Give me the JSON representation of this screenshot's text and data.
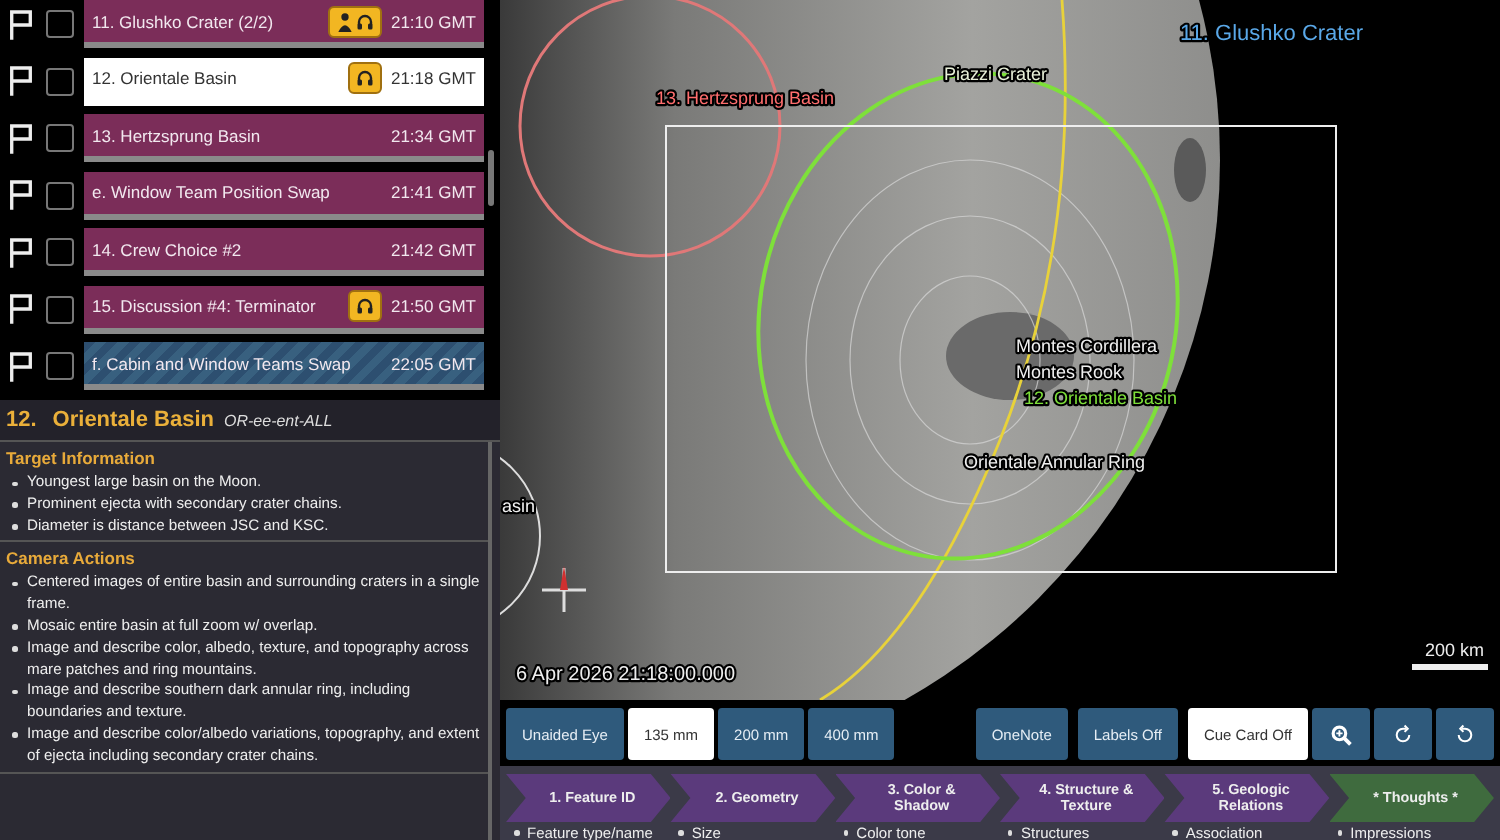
{
  "schedule": [
    {
      "title": "11. Glushko Crater (2/2)",
      "time": "21:10 GMT",
      "selected": false,
      "kind": "target",
      "person": true,
      "headset": true,
      "checked": false
    },
    {
      "title": "12. Orientale Basin",
      "time": "21:18 GMT",
      "selected": true,
      "kind": "target",
      "person": false,
      "headset": true,
      "checked": false
    },
    {
      "title": "13. Hertzsprung Basin",
      "time": "21:34 GMT",
      "selected": false,
      "kind": "target",
      "person": false,
      "headset": false,
      "checked": false
    },
    {
      "title": "e. Window Team Position Swap",
      "time": "21:41 GMT",
      "selected": false,
      "kind": "target",
      "person": false,
      "headset": false,
      "checked": false
    },
    {
      "title": "14. Crew Choice #2",
      "time": "21:42 GMT",
      "selected": false,
      "kind": "target",
      "person": false,
      "headset": false,
      "checked": false
    },
    {
      "title": "15. Discussion #4: Terminator",
      "time": "21:50 GMT",
      "selected": false,
      "kind": "target",
      "person": false,
      "headset": true,
      "checked": false
    },
    {
      "title": "f. Cabin and Window Teams Swap",
      "time": "22:05 GMT",
      "selected": false,
      "kind": "swap",
      "person": false,
      "headset": false,
      "checked": false
    }
  ],
  "detail": {
    "number": "12.",
    "name": "Orientale Basin",
    "pronunciation": "OR-ee-ent-ALL",
    "sections": [
      {
        "heading": "Target Information",
        "items": [
          "Youngest large basin on the Moon.",
          "Prominent ejecta with secondary crater chains.",
          "Diameter is distance between JSC and KSC."
        ]
      },
      {
        "heading": "Camera Actions",
        "items": [
          "Centered images of entire basin and surrounding craters in a single frame.",
          "Mosaic entire basin at full zoom w/ overlap.",
          "Image and describe color, albedo, texture, and topography across mare patches and ring mountains.",
          "Image and describe southern dark annular ring, including boundaries and texture.",
          "Image and describe color/albedo variations, topography, and extent of ejecta including secondary crater chains."
        ]
      }
    ]
  },
  "map": {
    "labels": [
      {
        "text": "11. Glushko Crater",
        "color": "#5aa8e8"
      },
      {
        "text": "Piazzi Crater",
        "color": "#e8f0d8"
      },
      {
        "text": "13. Hertzsprung Basin",
        "color": "#ff6e6e"
      },
      {
        "text": "Montes Cordillera",
        "color": "#f0f0f0"
      },
      {
        "text": "Montes Rook",
        "color": "#f0f0f0"
      },
      {
        "text": "12. Orientale Basin",
        "color": "#7ee03a"
      },
      {
        "text": "Orientale Annular Ring",
        "color": "#f0f0f0"
      },
      {
        "text": "asin",
        "color": "#f0f0f0"
      }
    ],
    "timestamp": "6 Apr 2026 21:18:00.000",
    "scale": "200 km"
  },
  "lenses": [
    {
      "label": "Unaided Eye",
      "selected": false
    },
    {
      "label": "135 mm",
      "selected": true
    },
    {
      "label": "200 mm",
      "selected": false
    },
    {
      "label": "400 mm",
      "selected": false
    }
  ],
  "toggles": [
    {
      "label": "OneNote",
      "on": false
    },
    {
      "label": "Labels Off",
      "on": false
    },
    {
      "label": "Cue Card Off",
      "on": true
    }
  ],
  "steps": [
    {
      "label": "1. Feature ID",
      "kind": "step",
      "item": "Feature type/name"
    },
    {
      "label": "2. Geometry",
      "kind": "step",
      "item": "Size"
    },
    {
      "label": "3. Color & Shadow",
      "kind": "step",
      "item": "Color tone"
    },
    {
      "label": "4. Structure & Texture",
      "kind": "step",
      "item": "Structures"
    },
    {
      "label": "5. Geologic Relations",
      "kind": "step",
      "item": "Association"
    },
    {
      "label": "* Thoughts *",
      "kind": "final",
      "item": "Impressions"
    }
  ]
}
